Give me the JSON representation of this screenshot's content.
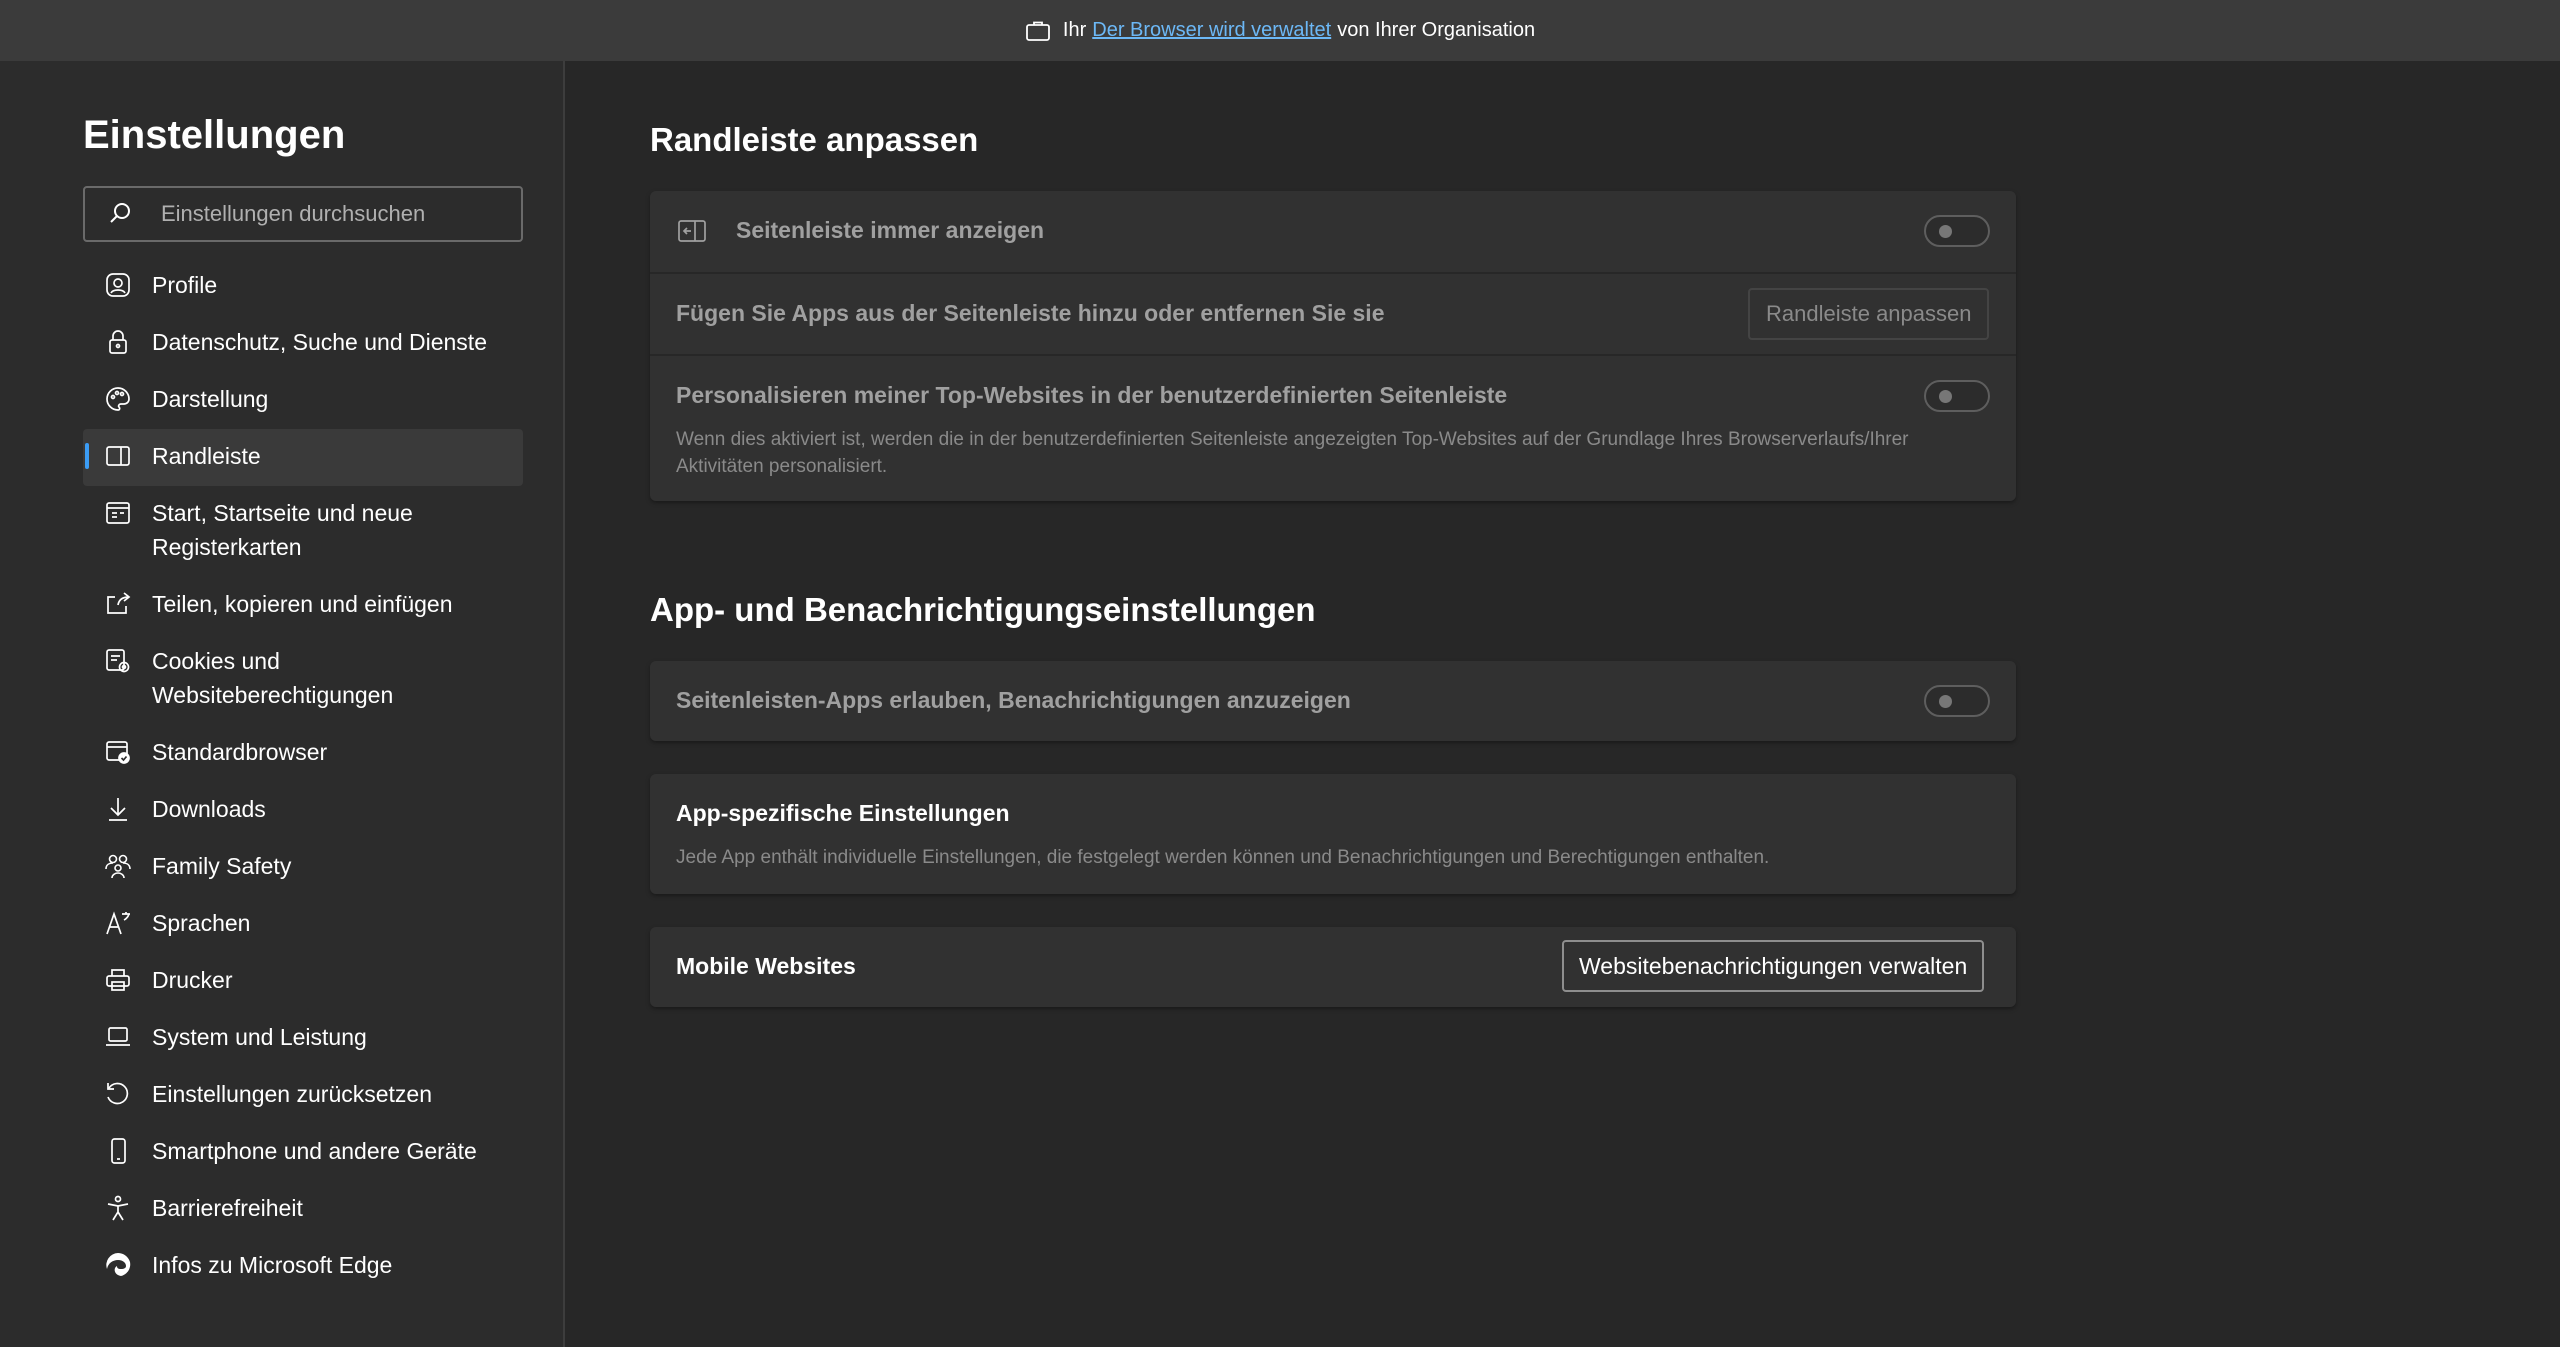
{
  "banner": {
    "prefix": "Ihr",
    "link": "Der Browser wird verwaltet",
    "suffix": "von Ihrer Organisation",
    "icon": "briefcase-icon"
  },
  "sidebar": {
    "title": "Einstellungen",
    "search_placeholder": "Einstellungen durchsuchen",
    "items": [
      {
        "label": "Profile",
        "icon": "profile-icon"
      },
      {
        "label": "Datenschutz, Suche und Dienste",
        "icon": "lock-icon"
      },
      {
        "label": "Darstellung",
        "icon": "palette-icon"
      },
      {
        "label": "Randleiste",
        "icon": "sidebar-icon",
        "active": true
      },
      {
        "label": "Start, Startseite und neue Registerkarten",
        "icon": "home-tabs-icon"
      },
      {
        "label": "Teilen, kopieren und einfügen",
        "icon": "share-icon"
      },
      {
        "label": "Cookies und Websiteberechtigungen",
        "icon": "cookies-icon"
      },
      {
        "label": "Standardbrowser",
        "icon": "default-browser-icon"
      },
      {
        "label": "Downloads",
        "icon": "download-icon"
      },
      {
        "label": "Family Safety",
        "icon": "family-icon"
      },
      {
        "label": "Sprachen",
        "icon": "languages-icon"
      },
      {
        "label": "Drucker",
        "icon": "printer-icon"
      },
      {
        "label": "System und Leistung",
        "icon": "laptop-icon"
      },
      {
        "label": "Einstellungen zurücksetzen",
        "icon": "reset-icon"
      },
      {
        "label": "Smartphone und andere Geräte",
        "icon": "phone-icon"
      },
      {
        "label": "Barrierefreiheit",
        "icon": "accessibility-icon"
      },
      {
        "label": "Infos zu Microsoft Edge",
        "icon": "edge-icon"
      }
    ]
  },
  "main": {
    "section1": {
      "title": "Randleiste anpassen",
      "always_show_label": "Seitenleiste immer anzeigen",
      "add_remove_label": "Fügen Sie Apps aus der Seitenleiste hinzu oder entfernen Sie sie",
      "customize_button": "Randleiste anpassen",
      "personalize_label": "Personalisieren meiner Top-Websites in der benutzerdefinierten Seitenleiste",
      "personalize_desc": "Wenn dies aktiviert ist, werden die in der benutzerdefinierten Seitenleiste angezeigten Top-Websites auf der Grundlage Ihres Browserverlaufs/Ihrer Aktivitäten personalisiert."
    },
    "section2": {
      "title": "App- und Benachrichtigungseinstellungen",
      "notifications_label": "Seitenleisten-Apps erlauben, Benachrichtigungen anzuzeigen",
      "app_specific_title": "App-spezifische Einstellungen",
      "app_specific_desc": "Jede App enthält individuelle Einstellungen, die festgelegt werden können und Benachrichtigungen und Berechtigungen enthalten.",
      "mobile_websites_label": "Mobile Websites",
      "manage_notifications_button": "Websitebenachrichtigungen verwalten"
    }
  },
  "toggles": {
    "always_show": false,
    "personalize": false,
    "notifications": false
  },
  "colors": {
    "accent": "#3b9cf4",
    "link": "#6cb8f6",
    "background": "#272727"
  }
}
